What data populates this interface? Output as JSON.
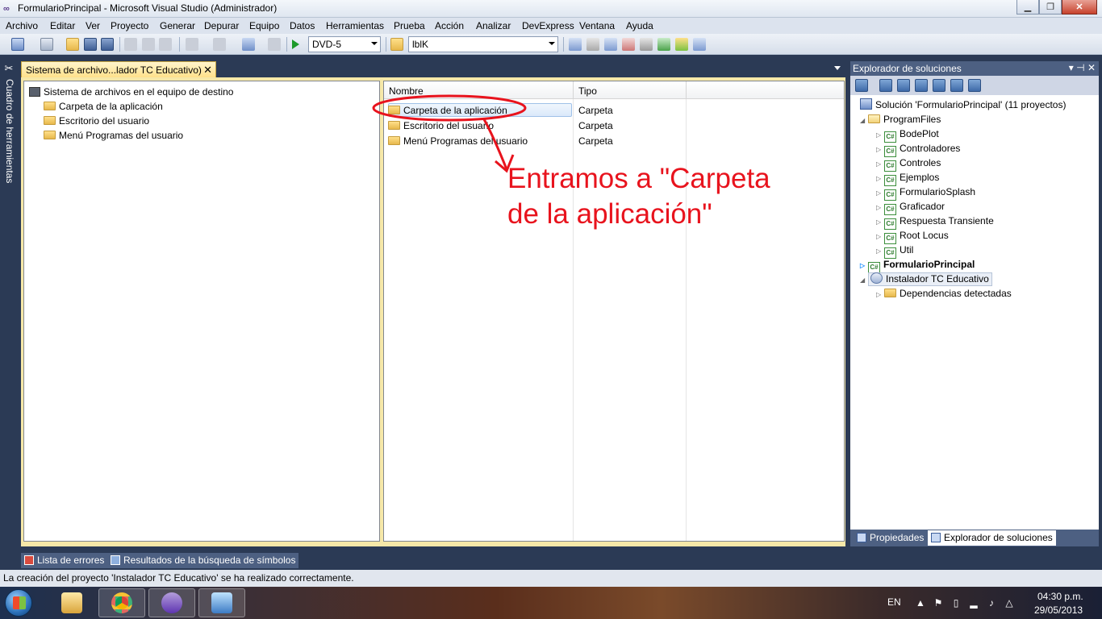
{
  "window": {
    "title": "FormularioPrincipal - Microsoft Visual Studio (Administrador)"
  },
  "menu": [
    "Archivo",
    "Editar",
    "Ver",
    "Proyecto",
    "Generar",
    "Depurar",
    "Equipo",
    "Datos",
    "Herramientas",
    "Prueba",
    "Acción",
    "Analizar",
    "DevExpress",
    "Ventana",
    "Ayuda"
  ],
  "toolbar": {
    "config_value": "DVD-5",
    "find_value": "lblK"
  },
  "toolbox": {
    "label": "Cuadro de herramientas"
  },
  "document": {
    "tab_title": "Sistema de archivo...lador TC Educativo)",
    "tab_close": "✕",
    "tree": {
      "root": "Sistema de archivos en el equipo de destino",
      "items": [
        "Carpeta de la aplicación",
        "Escritorio del usuario",
        "Menú Programas del usuario"
      ]
    },
    "list": {
      "columns": [
        "Nombre",
        "Tipo"
      ],
      "rows": [
        {
          "name": "Carpeta de la aplicación",
          "type": "Carpeta"
        },
        {
          "name": "Escritorio del usuario",
          "type": "Carpeta"
        },
        {
          "name": "Menú Programas del usuario",
          "type": "Carpeta"
        }
      ]
    }
  },
  "annotation": {
    "line1": "Entramos a \"Carpeta",
    "line2": "de la aplicación\"",
    "color": "#e8131d"
  },
  "solution_explorer": {
    "title": "Explorador de soluciones",
    "pin_controls": "▾ ⊣ ✕",
    "solution": "Solución 'FormularioPrincipal'  (11 proyectos)",
    "program_files": "ProgramFiles",
    "projects": [
      "BodePlot",
      "Controladores",
      "Controles",
      "Ejemplos",
      "FormularioSplash",
      "Graficador",
      "Respuesta Transiente",
      "Root Locus",
      "Util"
    ],
    "startup_project": "FormularioPrincipal",
    "installer_project": "Instalador TC Educativo",
    "installer_child": "Dependencias detectadas",
    "bottom_tabs": [
      "Propiedades",
      "Explorador de soluciones"
    ]
  },
  "bottom_tool_tabs": [
    "Lista de errores",
    "Resultados de la búsqueda de símbolos"
  ],
  "status": {
    "message": "La creación del proyecto 'Instalador TC Educativo' se ha realizado correctamente."
  },
  "taskbar": {
    "language": "EN",
    "time": "04:30 p.m.",
    "date": "29/05/2013"
  }
}
